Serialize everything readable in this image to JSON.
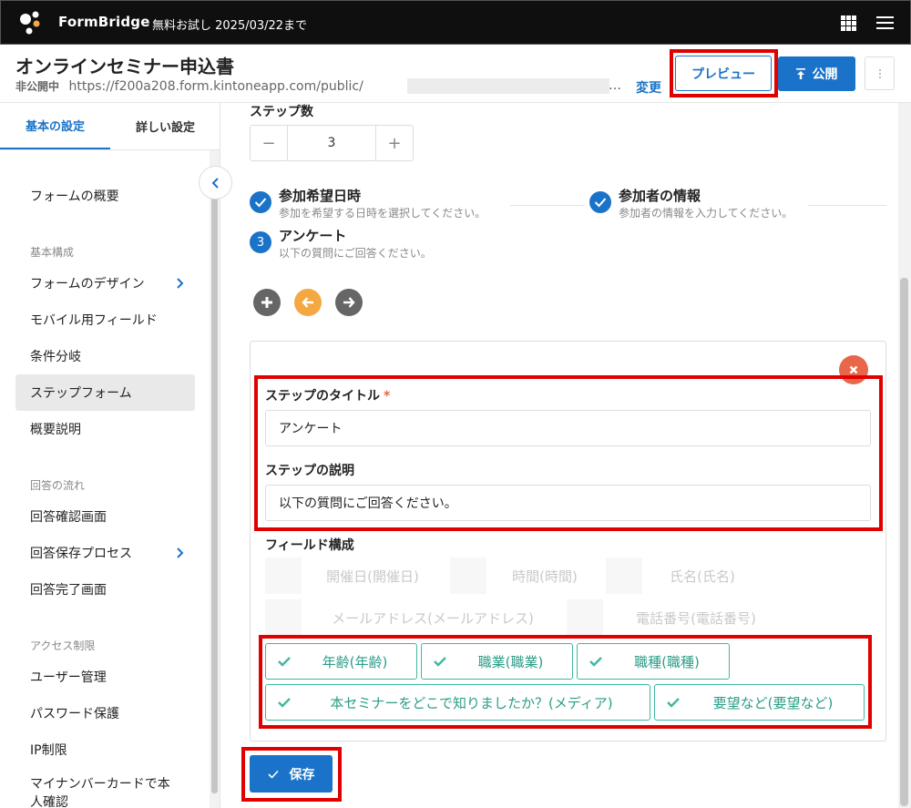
{
  "topbar": {
    "brand": "FormBridge",
    "trial_text": "無料お試し 2025/03/22まで"
  },
  "header": {
    "form_title": "オンラインセミナー申込書",
    "status_badge": "非公開中",
    "url_prefix": "https://f200a208.form.kintoneapp.com/public/",
    "url_ellipsis": "…",
    "change_label": "変更",
    "preview_label": "プレビュー",
    "publish_label": "公開"
  },
  "sidebar": {
    "tabs": [
      {
        "label": "基本の設定"
      },
      {
        "label": "詳しい設定"
      }
    ],
    "overview": "フォームの概要",
    "groups": {
      "basic": "基本構成",
      "flow": "回答の流れ",
      "access": "アクセス制限"
    },
    "items": [
      {
        "label": "フォームのデザイン"
      },
      {
        "label": "モバイル用フィールド"
      },
      {
        "label": "条件分岐"
      },
      {
        "label": "ステップフォーム"
      },
      {
        "label": "概要説明"
      },
      {
        "label": "回答確認画面"
      },
      {
        "label": "回答保存プロセス"
      },
      {
        "label": "回答完了画面"
      },
      {
        "label": "ユーザー管理"
      },
      {
        "label": "パスワード保護"
      },
      {
        "label": "IP制限"
      },
      {
        "label": "マイナンバーカードで本人確認"
      }
    ]
  },
  "main": {
    "steps_count_label": "ステップ数",
    "steps_count_value": "3",
    "steps": [
      {
        "marker": "",
        "title": "参加希望日時",
        "desc": "参加を希望する日時を選択してください。"
      },
      {
        "marker": "",
        "title": "参加者の情報",
        "desc": "参加者の情報を入力してください。"
      },
      {
        "marker": "3",
        "title": "アンケート",
        "desc": "以下の質問にご回答ください。"
      }
    ],
    "card": {
      "title_label": "ステップのタイトル",
      "required_mark": "*",
      "title_value": "アンケート",
      "desc_label": "ステップの説明",
      "desc_value": "以下の質問にご回答ください。",
      "fields_label": "フィールド構成",
      "fields_off": [
        {
          "label": "開催日(開催日)"
        },
        {
          "label": "時間(時間)"
        },
        {
          "label": "氏名(氏名)"
        },
        {
          "label": "メールアドレス(メールアドレス)"
        },
        {
          "label": "電話番号(電話番号)"
        }
      ],
      "fields_on": [
        {
          "label": "年齢(年齢)"
        },
        {
          "label": "職業(職業)"
        },
        {
          "label": "職種(職種)"
        },
        {
          "label": "本セミナーをどこで知りましたか？(メディア)"
        },
        {
          "label": "要望など(要望など)"
        }
      ]
    },
    "save_label": "保存"
  },
  "colors": {
    "primary": "#1a73c8",
    "topbar": "#0f0f0f",
    "highlight": "#e00000",
    "check_green": "#2b9d87",
    "prev_orange": "#f5a742",
    "close_red": "#e8664a"
  }
}
